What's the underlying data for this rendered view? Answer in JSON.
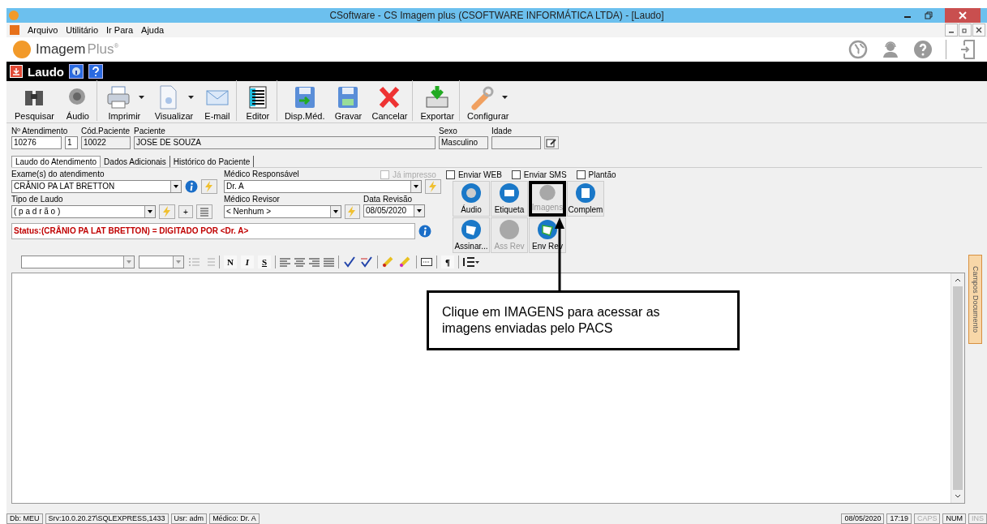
{
  "window": {
    "title": "CSoftware - CS Imagem plus (CSOFTWARE INFORMÁTICA LTDA) - [Laudo]"
  },
  "menu": [
    "Arquivo",
    "Utilitário",
    "Ir Para",
    "Ajuda"
  ],
  "brand": {
    "name": "Imagem",
    "suffix": "Plus",
    "mark": "®"
  },
  "form_title": "Laudo",
  "toolbar": [
    {
      "label": "Pesquisar",
      "kind": "binoculars",
      "dropdown": false,
      "group_end": false
    },
    {
      "label": "Áudio",
      "kind": "speaker",
      "dropdown": false,
      "group_end": true
    },
    {
      "label": "Imprimir",
      "kind": "printer",
      "dropdown": true,
      "group_end": false
    },
    {
      "label": "Visualizar",
      "kind": "document",
      "dropdown": true,
      "group_end": false
    },
    {
      "label": "E-mail",
      "kind": "envelope",
      "dropdown": false,
      "group_end": true
    },
    {
      "label": "Editor",
      "kind": "editor",
      "dropdown": false,
      "group_end": true
    },
    {
      "label": "Disp.Méd.",
      "kind": "floppy-arrow",
      "dropdown": false,
      "group_end": false
    },
    {
      "label": "Gravar",
      "kind": "floppy",
      "dropdown": false,
      "group_end": false
    },
    {
      "label": "Cancelar",
      "kind": "cross",
      "dropdown": false,
      "group_end": true
    },
    {
      "label": "Exportar",
      "kind": "export",
      "dropdown": false,
      "group_end": true
    },
    {
      "label": "Configurar",
      "kind": "wrench",
      "dropdown": true,
      "group_end": false
    }
  ],
  "patient": {
    "fields": [
      {
        "label": "Nº Atendimento",
        "value": "10276",
        "extra": "1"
      },
      {
        "label": "Cód.Paciente",
        "value": "10022"
      },
      {
        "label": "Paciente",
        "value": "JOSE DE SOUZA"
      },
      {
        "label": "Sexo",
        "value": "Masculino"
      },
      {
        "label": "Idade"
      }
    ]
  },
  "tabs": [
    {
      "label": "Laudo do Atendimento",
      "selected": true
    },
    {
      "label": "Dados Adicionais",
      "selected": false
    },
    {
      "label": "Histórico do Paciente",
      "selected": false
    }
  ],
  "checks": [
    {
      "label": "Já impresso",
      "checked": false,
      "disabled": true
    },
    {
      "label": "Enviar WEB",
      "checked": false,
      "disabled": false
    },
    {
      "label": "Enviar SMS",
      "checked": false,
      "disabled": false
    },
    {
      "label": "Plantão",
      "checked": false,
      "disabled": false
    }
  ],
  "exams": {
    "label": "Exame(s) do atendimento",
    "value": "CRÂNIO PA LAT BRETTON"
  },
  "doctor": {
    "label": "Médico Responsável",
    "value": "Dr. A"
  },
  "report_type": {
    "label": "Tipo de Laudo",
    "value": "( p a d r ã o )",
    "plus": "+"
  },
  "reviewer": {
    "label": "Médico Revisor",
    "value": "< Nenhum >"
  },
  "review_date": {
    "label": "Data Revisão",
    "value": "08/05/2020"
  },
  "status": "Status:(CRÂNIO PA LAT BRETTON) = DIGITADO POR <Dr. A>",
  "actions": [
    {
      "label": "Áudio",
      "kind": "speaker",
      "disabled": false,
      "highlighted": false
    },
    {
      "label": "Etiqueta",
      "kind": "printer",
      "disabled": false,
      "highlighted": false
    },
    {
      "label": "Imagens",
      "kind": "none",
      "disabled": true,
      "highlighted": true
    },
    {
      "label": "Complem",
      "kind": "note",
      "disabled": false,
      "highlighted": false
    },
    {
      "label": "Assinar...",
      "kind": "sign",
      "disabled": false,
      "highlighted": false
    },
    {
      "label": "Ass Rev",
      "kind": "none",
      "disabled": true,
      "highlighted": false
    },
    {
      "label": "Env Rev",
      "kind": "sign-send",
      "disabled": false,
      "highlighted": false
    }
  ],
  "format_bar": {
    "bold": "N",
    "italic": "I",
    "strike": "S",
    "pilcrow": "¶"
  },
  "callout": "Clique em IMAGENS para acessar as imagens enviadas pelo PACS",
  "side_tab": "Campos Documento",
  "status_bar": [
    {
      "text": "Db: MEU",
      "disabled": false
    },
    {
      "text": "Srv:10.0.20.27\\SQLEXPRESS,1433",
      "disabled": false
    },
    {
      "text": "Usr: adm",
      "disabled": false
    },
    {
      "text": "Médico: Dr. A",
      "disabled": false
    },
    {
      "text": "08/05/2020",
      "disabled": false,
      "right": true
    },
    {
      "text": "17:19",
      "disabled": false
    },
    {
      "text": "CAPS",
      "disabled": true
    },
    {
      "text": "NUM",
      "disabled": false
    },
    {
      "text": "INS",
      "disabled": true
    }
  ]
}
